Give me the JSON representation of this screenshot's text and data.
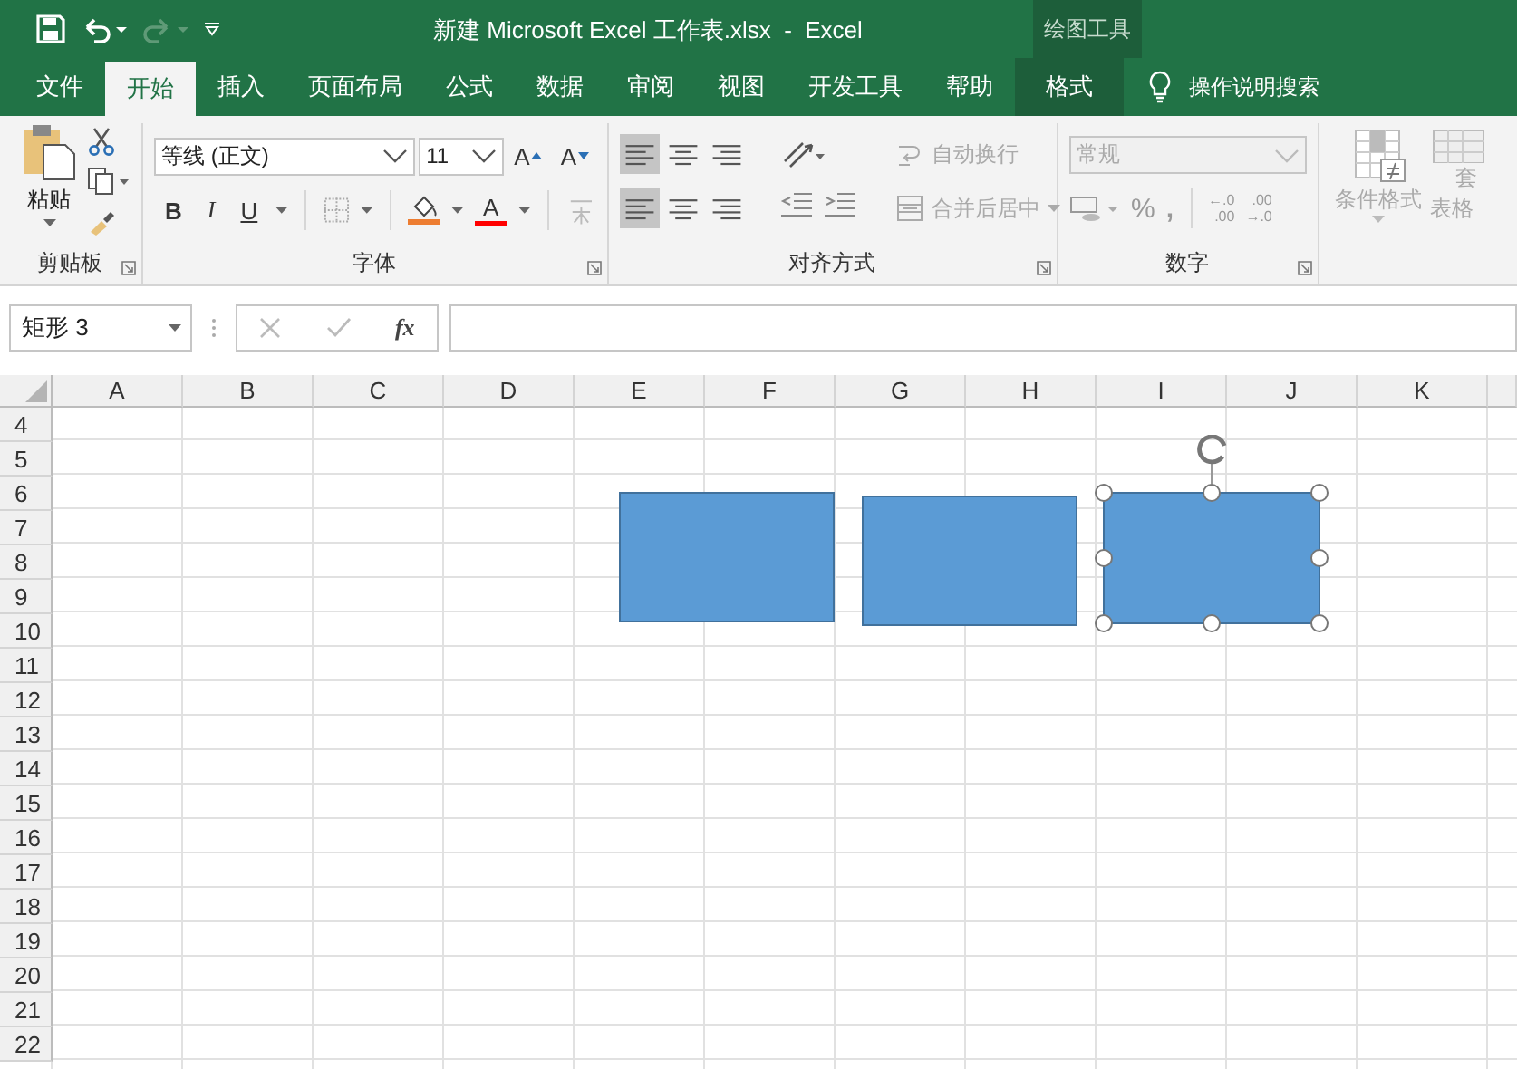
{
  "title_bar": {
    "title": "新建 Microsoft Excel 工作表.xlsx  -  Excel",
    "contextual_group": "绘图工具",
    "redo_disabled": true
  },
  "tabs": [
    {
      "label": "文件",
      "selected": false,
      "contextual": false
    },
    {
      "label": "开始",
      "selected": true,
      "contextual": false
    },
    {
      "label": "插入",
      "selected": false,
      "contextual": false
    },
    {
      "label": "页面布局",
      "selected": false,
      "contextual": false
    },
    {
      "label": "公式",
      "selected": false,
      "contextual": false
    },
    {
      "label": "数据",
      "selected": false,
      "contextual": false
    },
    {
      "label": "审阅",
      "selected": false,
      "contextual": false
    },
    {
      "label": "视图",
      "selected": false,
      "contextual": false
    },
    {
      "label": "开发工具",
      "selected": false,
      "contextual": false
    },
    {
      "label": "帮助",
      "selected": false,
      "contextual": false
    },
    {
      "label": "格式",
      "selected": false,
      "contextual": true
    }
  ],
  "tell_me": "操作说明搜索",
  "ribbon": {
    "clipboard": {
      "paste": "粘贴",
      "label": "剪贴板"
    },
    "font": {
      "font_name": "等线 (正文)",
      "font_size": "11",
      "grow": "A",
      "shrink": "A",
      "bold": "B",
      "italic": "I",
      "underline": "U",
      "font_color_letter": "A",
      "label": "字体"
    },
    "alignment": {
      "vertical_align": [
        {
          "selected": true
        },
        {
          "selected": false
        },
        {
          "selected": false
        }
      ],
      "horizontal_align": [
        {
          "selected": true
        },
        {
          "selected": false
        },
        {
          "selected": false
        }
      ],
      "wrap": {
        "label": "自动换行",
        "disabled": true
      },
      "merge": {
        "label": "合并后居中",
        "disabled": true
      },
      "label": "对齐方式"
    },
    "number": {
      "format": "常规",
      "format_disabled": true,
      "percent": "%",
      "comma": ",",
      "decimals": [
        {
          "top": "←.0",
          "bottom": ".00"
        },
        {
          "top": ".00",
          "bottom": "→.0"
        }
      ],
      "label": "数字"
    },
    "styles": {
      "conditional": "条件格式",
      "table_top": "套",
      "table_bottom": "表格",
      "disabled": true
    }
  },
  "formula_bar": {
    "name_box": "矩形 3",
    "function_label": "fx"
  },
  "sheet": {
    "columns": [
      "A",
      "B",
      "C",
      "D",
      "E",
      "F",
      "G",
      "H",
      "I",
      "J",
      "K"
    ],
    "rows": [
      "4",
      "5",
      "6",
      "7",
      "8",
      "9",
      "10",
      "11",
      "12",
      "13",
      "14",
      "15",
      "16",
      "17",
      "18",
      "19",
      "20",
      "21",
      "22"
    ],
    "shapes": [
      {
        "kind": "rectangle",
        "selected": false
      },
      {
        "kind": "rectangle",
        "selected": false
      },
      {
        "kind": "rectangle",
        "selected": true
      }
    ]
  }
}
